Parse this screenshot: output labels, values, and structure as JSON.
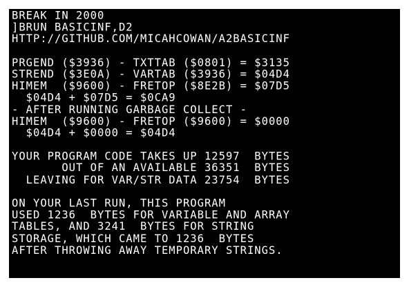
{
  "terminal": {
    "lines": [
      "BREAK IN 2000",
      "]BRUN BASICINF,D2",
      "HTTP://GITHUB.COM/MICAHCOWAN/A2BASICINF",
      "",
      "PRGEND ($3936) - TXTTAB ($0801) = $3135",
      "STREND ($3E0A) - VARTAB ($3936) = $04D4",
      "HIMEM  ($9600) - FRETOP ($8E2B) = $07D5",
      "  $04D4 + $07D5 = $0CA9",
      "- AFTER RUNNING GARBAGE COLLECT -",
      "HIMEM  ($9600) - FRETOP ($9600) = $0000",
      "  $04D4 + $0000 = $04D4",
      "",
      "YOUR PROGRAM CODE TAKES UP 12597  BYTES",
      "       OUT OF AN AVAILABLE 36351  BYTES",
      "  LEAVING FOR VAR/STR DATA 23754  BYTES",
      "",
      "ON YOUR LAST RUN, THIS PROGRAM",
      "USED 1236  BYTES FOR VARIABLE AND ARRAY",
      "TABLES, AND 3241  BYTES FOR STRING",
      "STORAGE, WHICH CAME TO 1236  BYTES",
      "AFTER THROWING AWAY TEMPORARY STRINGS.",
      "",
      ""
    ],
    "prompt": "]"
  }
}
